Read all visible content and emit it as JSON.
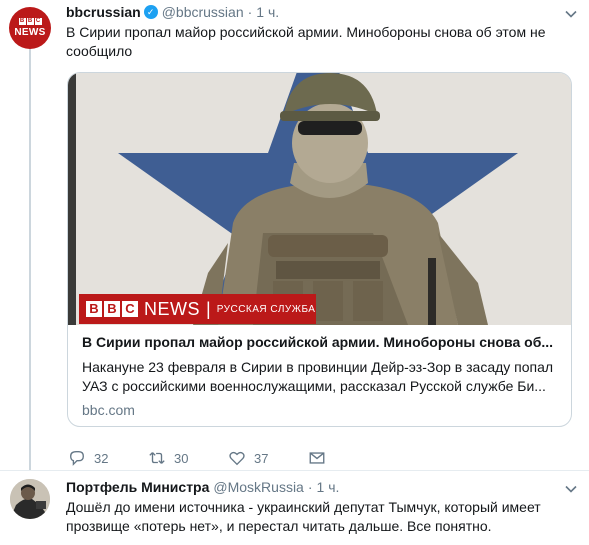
{
  "tweet": {
    "author_name": "bbcrussian",
    "author_handle": "@bbcrussian",
    "separator": "·",
    "time": "1 ч.",
    "avatar_logo": {
      "blocks": [
        "B",
        "B",
        "C"
      ],
      "word": "NEWS"
    },
    "text": "В Сирии пропал майор российской армии. Минобороны снова об этом не сообщило",
    "card": {
      "banner": {
        "blocks": [
          "B",
          "B",
          "C"
        ],
        "news": "NEWS",
        "separator": "|",
        "service": "РУССКАЯ СЛУЖБА"
      },
      "title": "В Сирии пропал майор российской армии. Минобороны снова об...",
      "description": "Накануне 23 февраля в Сирии в провинции Дейр-эз-Зор в засаду попал УАЗ с российскими военнослужащими, рассказал Русской службе Би...",
      "domain": "bbc.com"
    },
    "actions": {
      "replies": "32",
      "retweets": "30",
      "likes": "37"
    }
  },
  "reply": {
    "author_name": "Портфель Министра",
    "author_handle": "@MoskRussia",
    "separator": "·",
    "time": "1 ч.",
    "text": "Дошёл до имени источника - украинский депутат Тымчук, который имеет прозвище «потерь нет»,  и перестал читать дальше. Все понятно."
  },
  "colors": {
    "bbc_red": "#bb1919",
    "verified_blue": "#1da1f2",
    "muted_text": "#657786",
    "border": "#ccd6dd"
  },
  "icons": [
    "verified-badge-icon",
    "chevron-down-icon",
    "reply-icon",
    "retweet-icon",
    "like-heart-icon",
    "direct-message-icon"
  ]
}
